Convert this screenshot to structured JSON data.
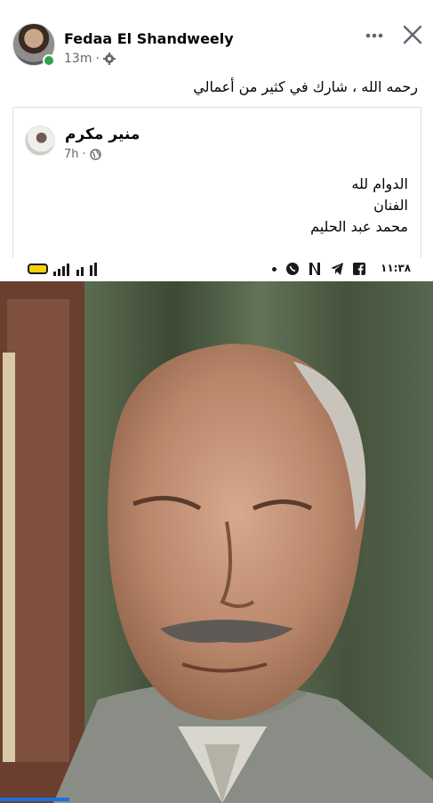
{
  "post": {
    "author": "Fedaa El Shandweely",
    "time": "13m",
    "caption": "رحمه الله ، شارك في كثير من أعمالي",
    "icons": {
      "audience": "gear-icon",
      "more": "more-dots-icon",
      "close": "close-icon"
    }
  },
  "shared_post": {
    "author": "منير مكرم",
    "time": "7h",
    "audience_icon": "globe-icon",
    "lines": [
      "الدوام لله",
      "الفنان",
      "محمد عبد الحليم"
    ]
  },
  "screenshot_status_bar": {
    "clock": "١١:٣٨",
    "icons": [
      "battery-icon",
      "signal-icon",
      "facebook-icon",
      "telegram-icon",
      "netflix-icon",
      "whatsapp-icon",
      "dot-icon"
    ]
  },
  "photo": {
    "subject": "portrait-photo"
  },
  "colors": {
    "online": "#31a24c",
    "meta": "#65676b",
    "accent": "#1c6fe0",
    "battery": "#f6d000"
  }
}
